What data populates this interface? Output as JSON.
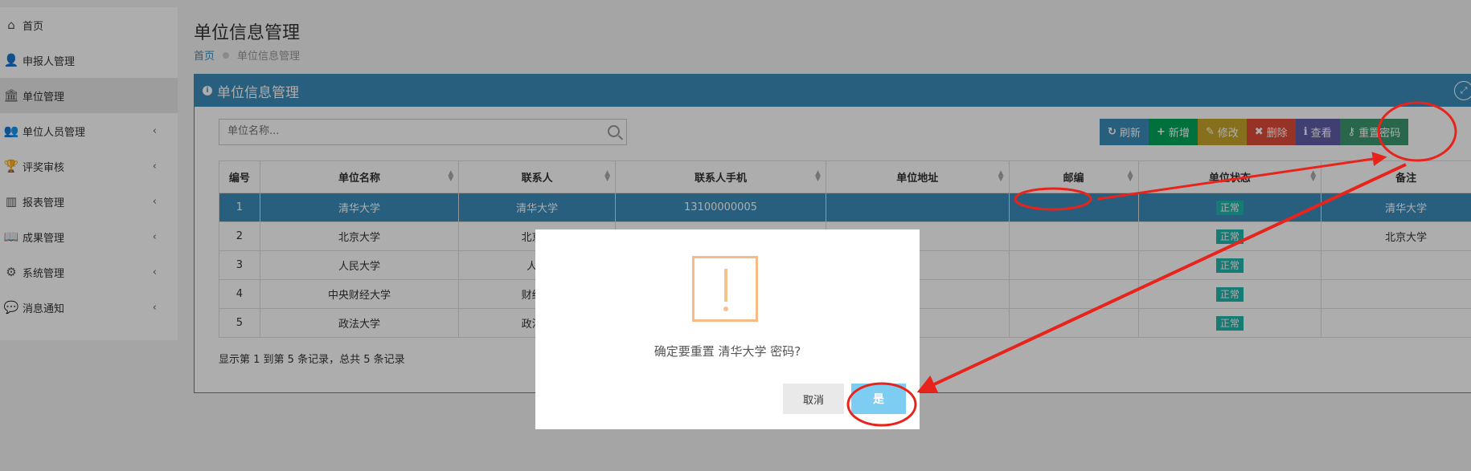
{
  "sidebar": {
    "items": [
      {
        "label": "首页",
        "icon": "home-icon",
        "chevron": false,
        "active": false
      },
      {
        "label": "申报人管理",
        "icon": "user-icon",
        "chevron": false,
        "active": false
      },
      {
        "label": "单位管理",
        "icon": "bank-icon",
        "chevron": false,
        "active": true
      },
      {
        "label": "单位人员管理",
        "icon": "users-icon",
        "chevron": true,
        "active": false
      },
      {
        "label": "评奖审核",
        "icon": "trophy-icon",
        "chevron": true,
        "active": false
      },
      {
        "label": "报表管理",
        "icon": "bar-chart-icon",
        "chevron": true,
        "active": false
      },
      {
        "label": "成果管理",
        "icon": "book-icon",
        "chevron": true,
        "active": false
      },
      {
        "label": "系统管理",
        "icon": "gear-icon",
        "chevron": true,
        "active": false
      },
      {
        "label": "消息通知",
        "icon": "comment-icon",
        "chevron": true,
        "active": false
      }
    ]
  },
  "header": {
    "title": "单位信息管理",
    "breadcrumb": {
      "home": "首页",
      "current": "单位信息管理"
    }
  },
  "panel": {
    "title": "单位信息管理",
    "search": {
      "placeholder": "单位名称...",
      "value": ""
    },
    "toolbar": [
      {
        "label": "刷新",
        "glyph": "↻",
        "color": "#3c8dbc"
      },
      {
        "label": "新增",
        "glyph": "+",
        "color": "#00a65a"
      },
      {
        "label": "修改",
        "glyph": "✎",
        "color": "#c8a52c"
      },
      {
        "label": "删除",
        "glyph": "✖",
        "color": "#dd4b39"
      },
      {
        "label": "查看",
        "glyph": "ℹ",
        "color": "#605ca8"
      },
      {
        "label": "重置密码",
        "glyph": "⚷",
        "color": "#3d9970"
      }
    ],
    "table": {
      "columns": [
        "编号",
        "单位名称",
        "联系人",
        "联系人手机",
        "单位地址",
        "邮编",
        "单位状态",
        "备注"
      ],
      "rows": [
        {
          "id": "1",
          "name": "清华大学",
          "contact": "清华大学",
          "phone": "13100000005",
          "address": "",
          "zip": "",
          "status": "正常",
          "note": "清华大学",
          "selected": true
        },
        {
          "id": "2",
          "name": "北京大学",
          "contact": "北京大",
          "phone": "",
          "address": "",
          "zip": "",
          "status": "正常",
          "note": "北京大学",
          "selected": false
        },
        {
          "id": "3",
          "name": "人民大学",
          "contact": "人大",
          "phone": "",
          "address": "",
          "zip": "",
          "status": "正常",
          "note": "",
          "selected": false
        },
        {
          "id": "4",
          "name": "中央财经大学",
          "contact": "财经大",
          "phone": "",
          "address": "",
          "zip": "",
          "status": "正常",
          "note": "",
          "selected": false
        },
        {
          "id": "5",
          "name": "政法大学",
          "contact": "政法大",
          "phone": "",
          "address": "",
          "zip": "",
          "status": "正常",
          "note": "",
          "selected": false
        }
      ]
    },
    "footer": "显示第 1 到第 5 条记录，总共 5 条记录"
  },
  "dialog": {
    "message": "确定要重置 清华大学 密码?",
    "cancel_label": "取消",
    "confirm_label": "是",
    "icon": "warning-icon"
  },
  "annotation_color": "#e8231c"
}
